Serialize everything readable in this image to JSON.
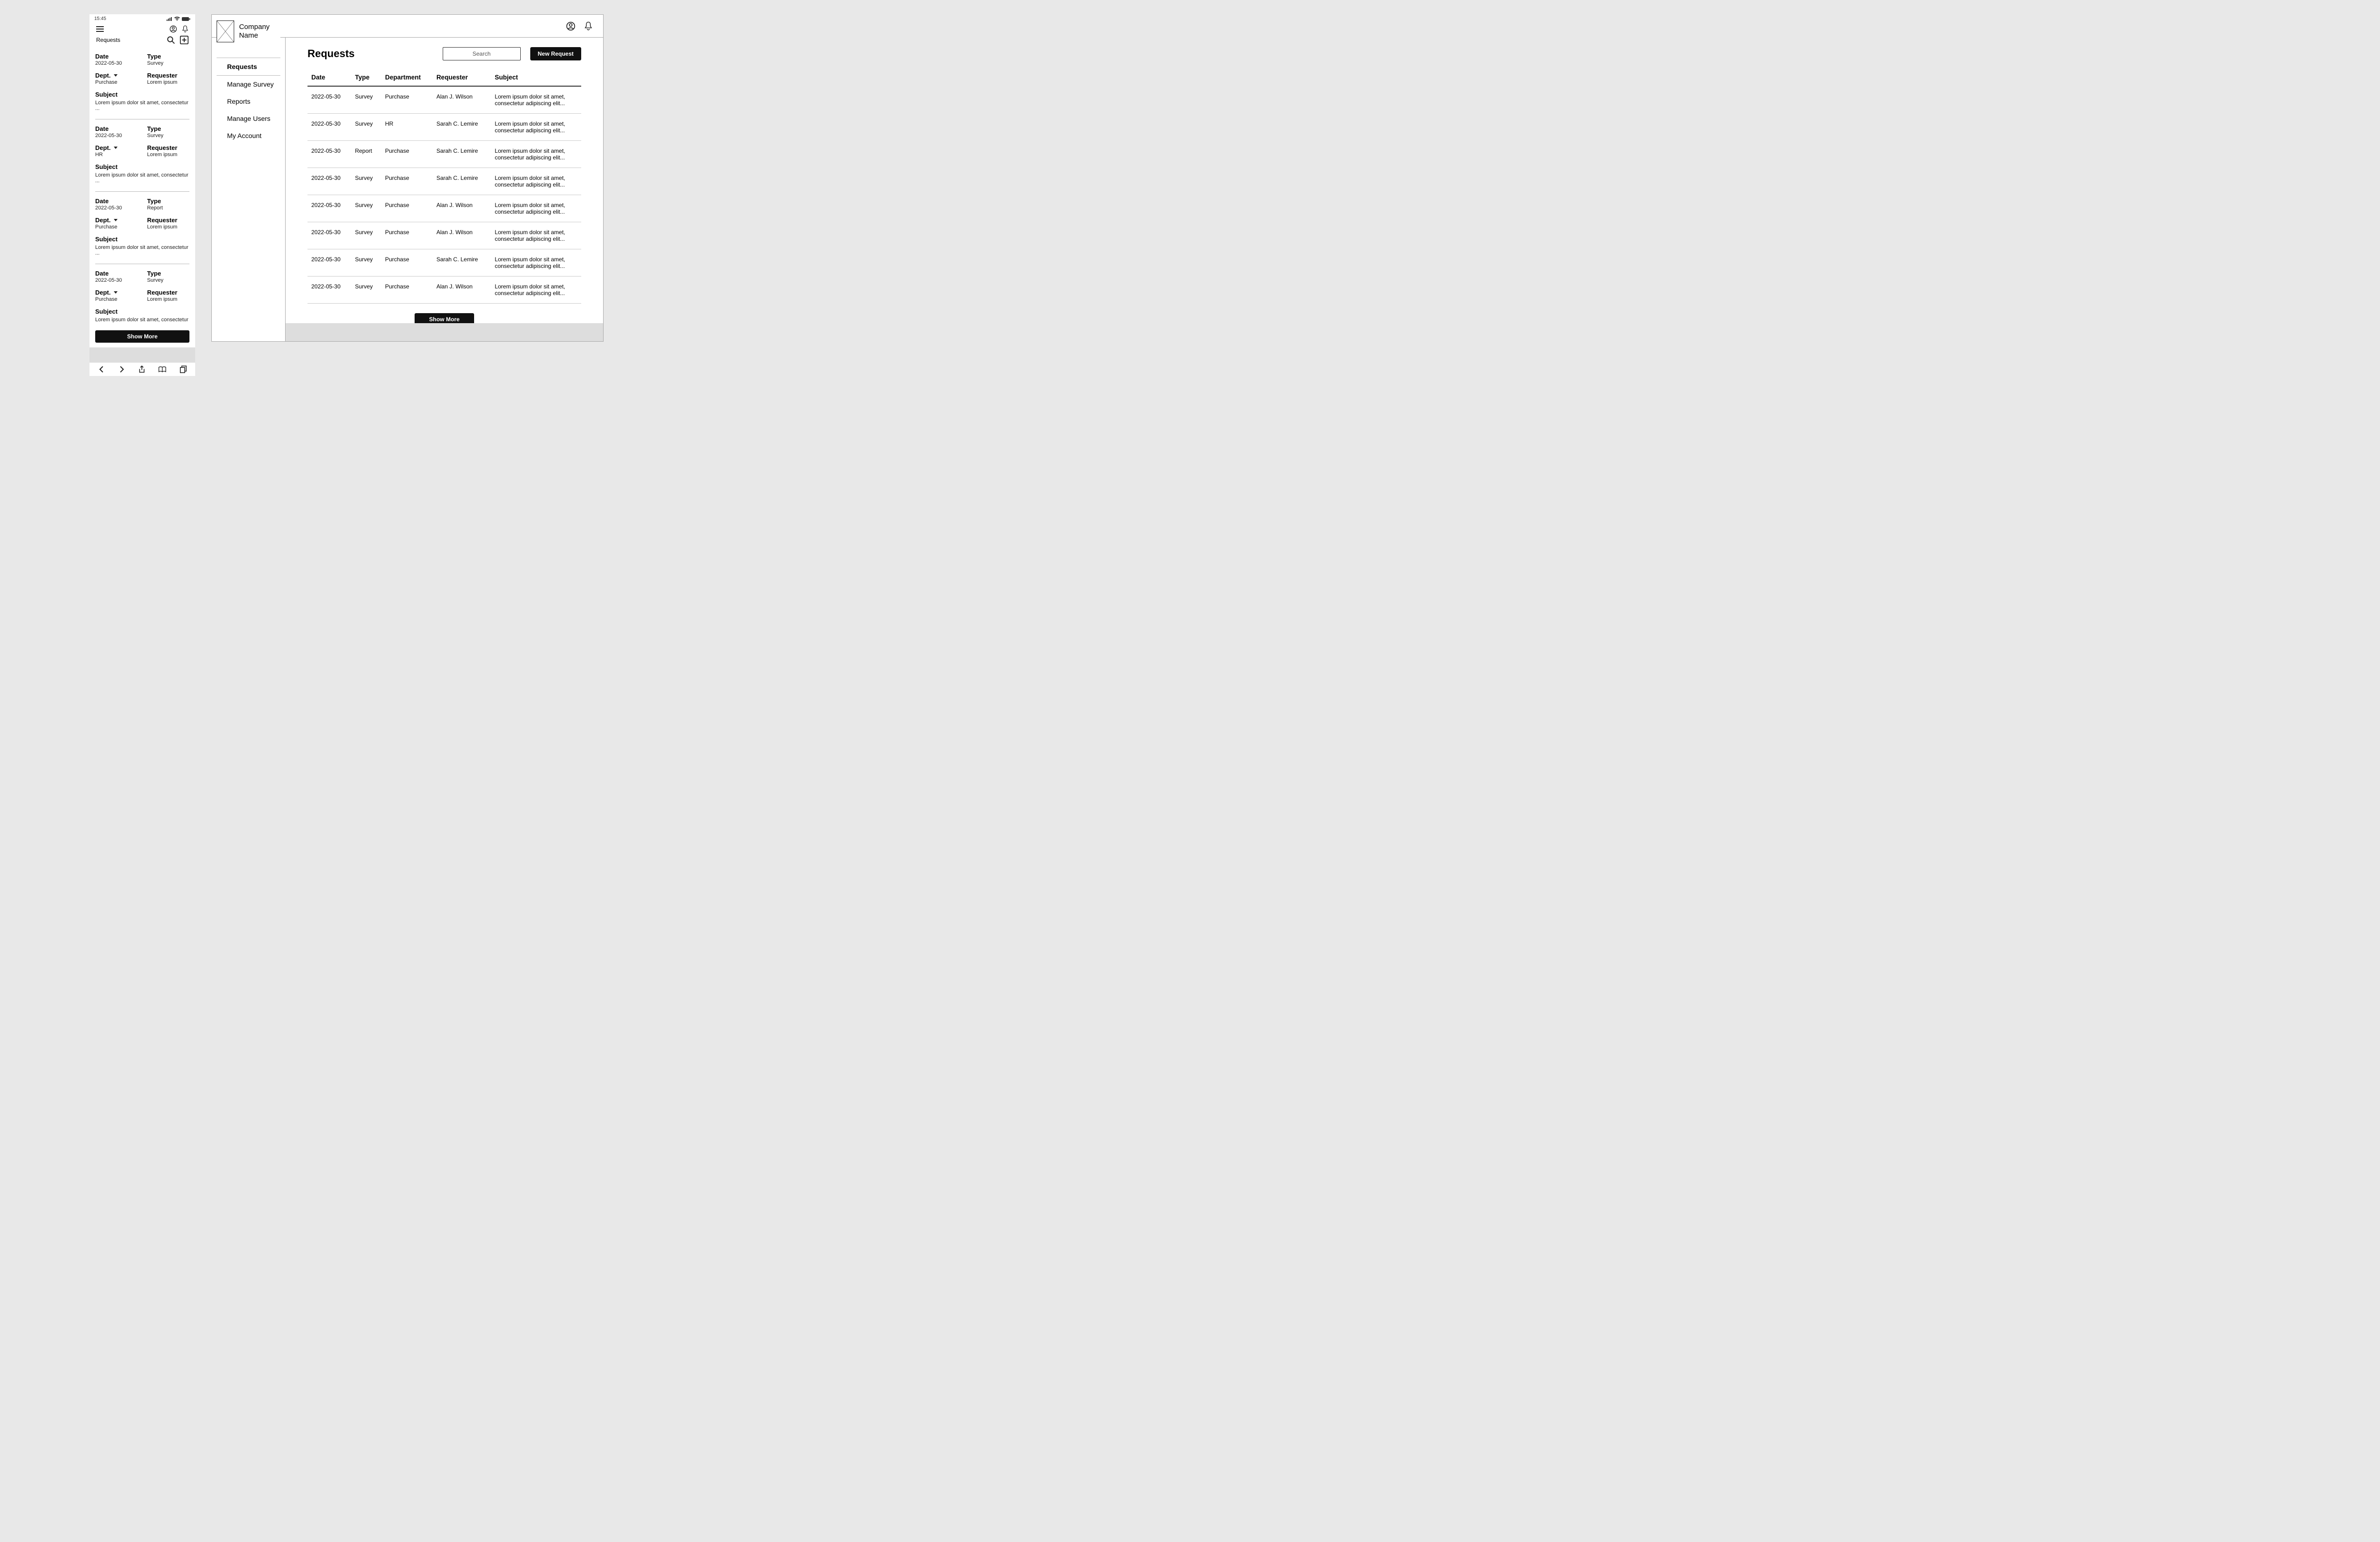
{
  "mobile": {
    "status_time": "15:45",
    "title": "Requests",
    "labels": {
      "date": "Date",
      "type": "Type",
      "dept": "Dept.",
      "requester": "Requester",
      "subject": "Subject"
    },
    "cards": [
      {
        "date": "2022-05-30",
        "type": "Survey",
        "dept": "Purchase",
        "requester": "Lorem ipsum",
        "subject": "Lorem ipsum dolor sit amet, consectetur ..."
      },
      {
        "date": "2022-05-30",
        "type": "Survey",
        "dept": "HR",
        "requester": "Lorem ipsum",
        "subject": "Lorem ipsum dolor sit amet, consectetur ..."
      },
      {
        "date": "2022-05-30",
        "type": "Report",
        "dept": "Purchase",
        "requester": "Lorem ipsum",
        "subject": "Lorem ipsum dolor sit amet, consectetur ..."
      },
      {
        "date": "2022-05-30",
        "type": "Survey",
        "dept": "Purchase",
        "requester": "Lorem ipsum",
        "subject": "Lorem ipsum dolor sit amet, consectetur ..."
      }
    ],
    "show_more": "Show More"
  },
  "desktop": {
    "company_name": "Company Name",
    "nav": {
      "requests": "Requests",
      "manage_survey": "Manage Survey",
      "reports": "Reports",
      "manage_users": "Manage Users",
      "my_account": "My Account"
    },
    "page_title": "Requests",
    "search_placeholder": "Search",
    "new_request": "New Request",
    "columns": {
      "date": "Date",
      "type": "Type",
      "department": "Department",
      "requester": "Requester",
      "subject": "Subject"
    },
    "rows": [
      {
        "date": "2022-05-30",
        "type": "Survey",
        "department": "Purchase",
        "requester": "Alan J. Wilson",
        "subject": "Lorem ipsum dolor sit amet, consectetur adipiscing elit..."
      },
      {
        "date": "2022-05-30",
        "type": "Survey",
        "department": "HR",
        "requester": "Sarah C. Lemire",
        "subject": "Lorem ipsum dolor sit amet, consectetur adipiscing elit..."
      },
      {
        "date": "2022-05-30",
        "type": "Report",
        "department": "Purchase",
        "requester": "Sarah C. Lemire",
        "subject": "Lorem ipsum dolor sit amet, consectetur adipiscing elit..."
      },
      {
        "date": "2022-05-30",
        "type": "Survey",
        "department": "Purchase",
        "requester": "Sarah C. Lemire",
        "subject": "Lorem ipsum dolor sit amet, consectetur adipiscing elit..."
      },
      {
        "date": "2022-05-30",
        "type": "Survey",
        "department": "Purchase",
        "requester": "Alan J. Wilson",
        "subject": "Lorem ipsum dolor sit amet, consectetur adipiscing elit..."
      },
      {
        "date": "2022-05-30",
        "type": "Survey",
        "department": "Purchase",
        "requester": "Alan J. Wilson",
        "subject": "Lorem ipsum dolor sit amet, consectetur adipiscing elit..."
      },
      {
        "date": "2022-05-30",
        "type": "Survey",
        "department": "Purchase",
        "requester": "Sarah C. Lemire",
        "subject": "Lorem ipsum dolor sit amet, consectetur adipiscing elit..."
      },
      {
        "date": "2022-05-30",
        "type": "Survey",
        "department": "Purchase",
        "requester": "Alan J. Wilson",
        "subject": "Lorem ipsum dolor sit amet, consectetur adipiscing elit..."
      }
    ],
    "show_more": "Show More"
  }
}
